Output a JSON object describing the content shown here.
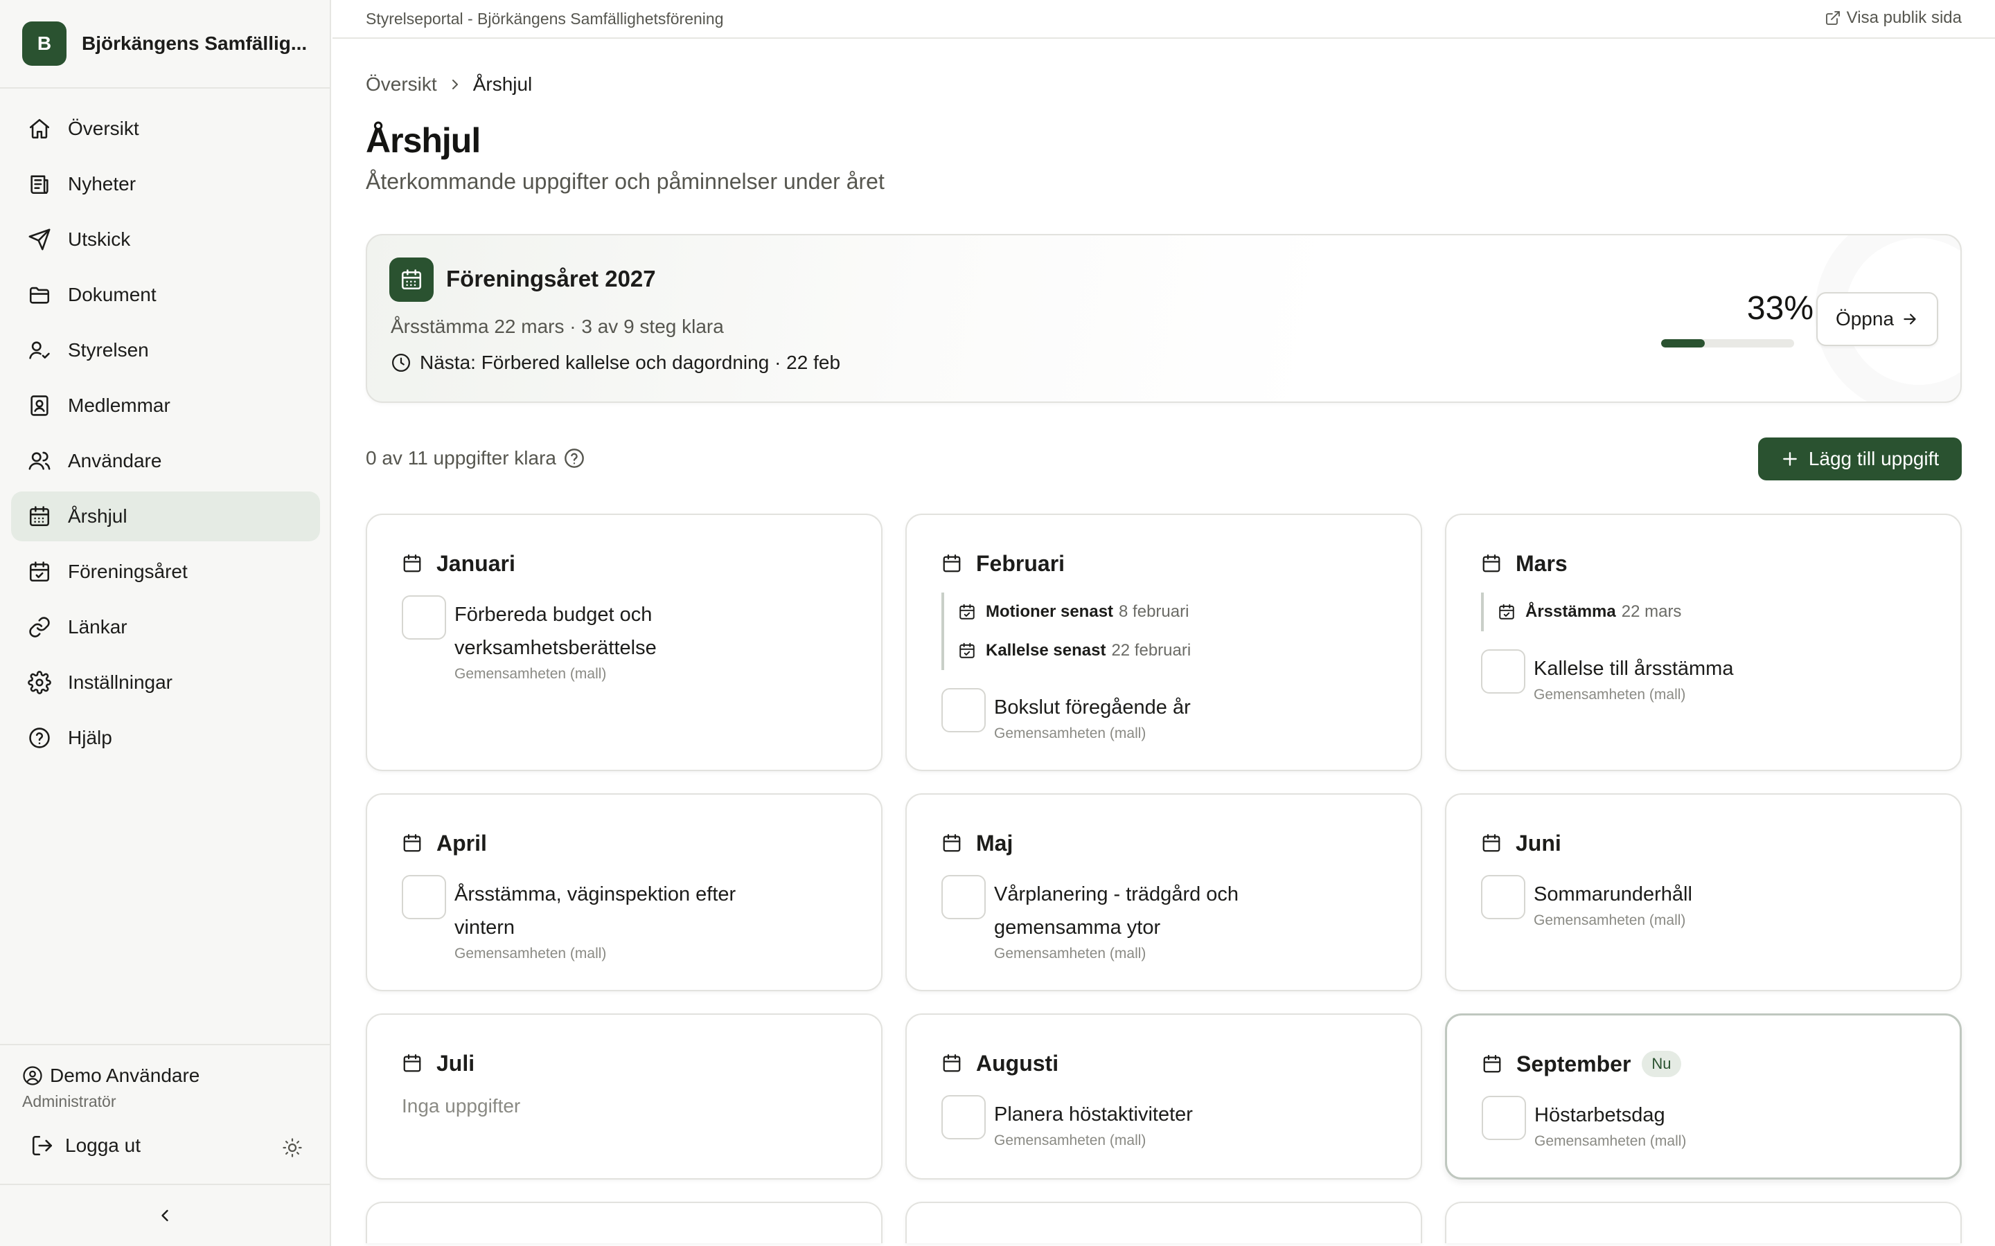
{
  "org": {
    "initial": "B",
    "name": "Björkängens Samfällig..."
  },
  "nav": [
    {
      "id": "oversikt",
      "label": "Översikt",
      "icon": "home-icon"
    },
    {
      "id": "nyheter",
      "label": "Nyheter",
      "icon": "newspaper-icon"
    },
    {
      "id": "utskick",
      "label": "Utskick",
      "icon": "send-icon"
    },
    {
      "id": "dokument",
      "label": "Dokument",
      "icon": "folder-icon"
    },
    {
      "id": "styrelsen",
      "label": "Styrelsen",
      "icon": "user-check-icon"
    },
    {
      "id": "medlemmar",
      "label": "Medlemmar",
      "icon": "contact-book-icon"
    },
    {
      "id": "anvandare",
      "label": "Användare",
      "icon": "users-icon"
    },
    {
      "id": "arshjul",
      "label": "Årshjul",
      "icon": "calendar-grid-icon",
      "active": true
    },
    {
      "id": "foreningsaret",
      "label": "Föreningsåret",
      "icon": "calendar-check-icon"
    },
    {
      "id": "lankar",
      "label": "Länkar",
      "icon": "link-icon"
    },
    {
      "id": "installningar",
      "label": "Inställningar",
      "icon": "gear-icon"
    },
    {
      "id": "hjalp",
      "label": "Hjälp",
      "icon": "help-circle-icon"
    }
  ],
  "user": {
    "name": "Demo Användare",
    "role": "Administratör",
    "logout_label": "Logga ut"
  },
  "topbar": {
    "title": "Styrelseportal - Björkängens Samfällighetsförening",
    "public_link": "Visa publik sida"
  },
  "breadcrumb": {
    "parent": "Översikt",
    "current": "Årshjul"
  },
  "page": {
    "title": "Årshjul",
    "subtitle": "Återkommande uppgifter och påminnelser under året"
  },
  "year_card": {
    "title": "Föreningsåret 2027",
    "meta": "Årsstämma 22 mars · 3 av 9 steg klara",
    "next": "Nästa: Förbered kallelse och dagordning · 22 feb",
    "percent_label": "33%",
    "progress": 0.33,
    "open_label": "Öppna"
  },
  "tasks": {
    "count_label": "0 av 11 uppgifter klara",
    "add_label": "Lägg till uppgift"
  },
  "months": [
    {
      "name": "Januari",
      "events": [],
      "tasks": [
        {
          "title": "Förbereda budget och verksamhetsberättelse",
          "source": "Gemensamheten (mall)"
        }
      ]
    },
    {
      "name": "Februari",
      "events": [
        {
          "label": "Motioner senast",
          "date": "8 februari"
        },
        {
          "label": "Kallelse senast",
          "date": "22 februari"
        }
      ],
      "tasks": [
        {
          "title": "Bokslut föregående år",
          "source": "Gemensamheten (mall)"
        }
      ]
    },
    {
      "name": "Mars",
      "events": [
        {
          "label": "Årsstämma",
          "date": "22 mars"
        }
      ],
      "tasks": [
        {
          "title": "Kallelse till årsstämma",
          "source": "Gemensamheten (mall)"
        }
      ]
    },
    {
      "name": "April",
      "events": [],
      "tasks": [
        {
          "title": "Årsstämma, väginspektion efter vintern",
          "source": "Gemensamheten (mall)"
        }
      ]
    },
    {
      "name": "Maj",
      "events": [],
      "tasks": [
        {
          "title": "Vårplanering - trädgård och gemensamma ytor",
          "source": "Gemensamheten (mall)"
        }
      ]
    },
    {
      "name": "Juni",
      "events": [],
      "tasks": [
        {
          "title": "Sommarunderhåll",
          "source": "Gemensamheten (mall)"
        }
      ]
    },
    {
      "name": "Juli",
      "events": [],
      "tasks": [],
      "empty_label": "Inga uppgifter"
    },
    {
      "name": "Augusti",
      "events": [],
      "tasks": [
        {
          "title": "Planera höstaktiviteter",
          "source": "Gemensamheten (mall)"
        }
      ]
    },
    {
      "name": "September",
      "badge": "Nu",
      "current": true,
      "events": [],
      "tasks": [
        {
          "title": "Höstarbetsdag",
          "source": "Gemensamheten (mall)"
        }
      ]
    }
  ],
  "colors": {
    "accent": "#2a5230",
    "active_bg": "#e5ebe4",
    "border": "#e2e2de",
    "muted_text": "#56564f"
  }
}
